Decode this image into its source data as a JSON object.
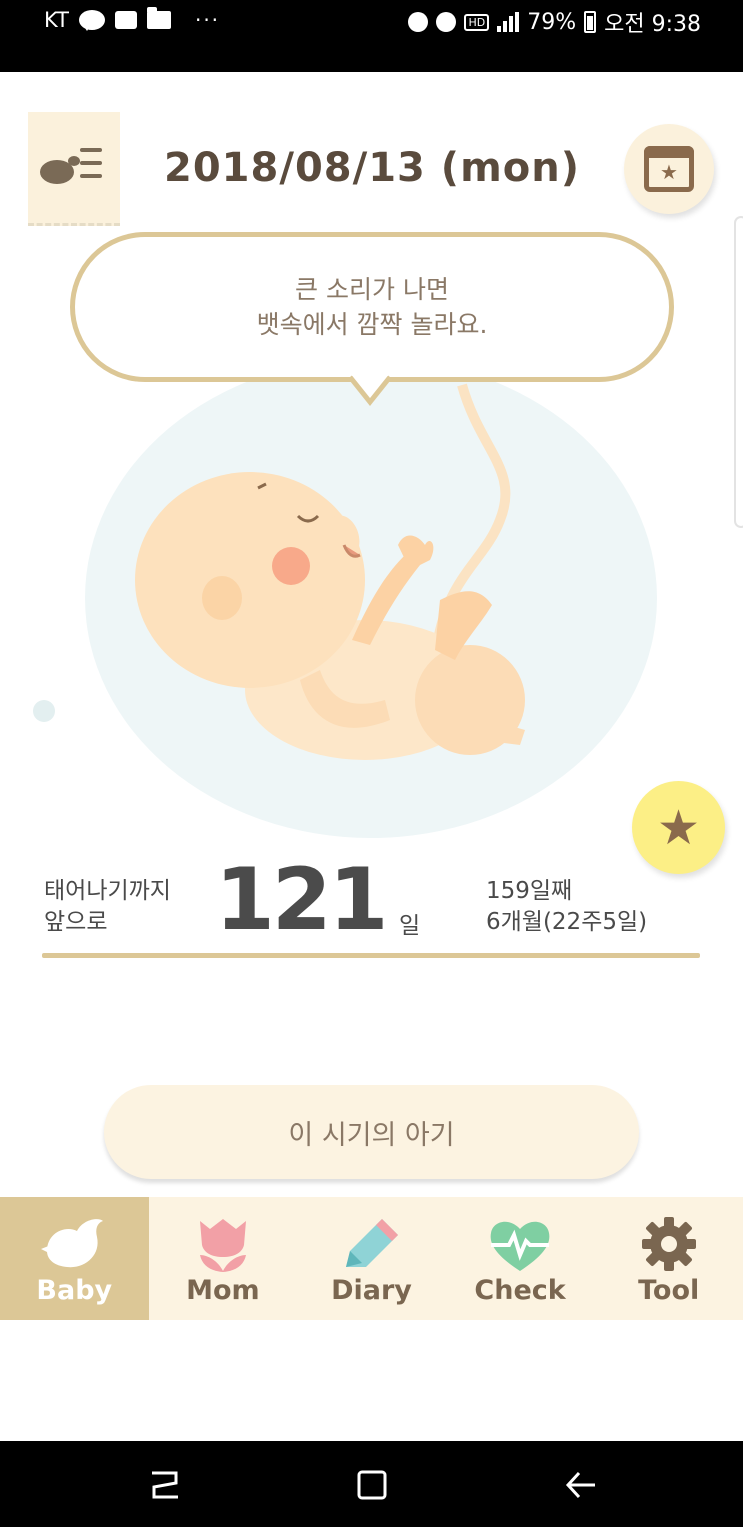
{
  "status_bar": {
    "carrier": "KT",
    "talk_icon": "TALK",
    "more": "···",
    "hd": "HD",
    "battery": "79%",
    "time": "오전 9:38"
  },
  "header": {
    "menu_icon": "menu-chick-icon",
    "date": "2018/08/13 (mon)",
    "calendar_icon": "calendar-star-icon"
  },
  "speech": {
    "line1": "큰 소리가 나면",
    "line2": "뱃속에서 깜짝 놀라요."
  },
  "countdown": {
    "label_line1": "태어나기까지",
    "label_line2": "앞으로",
    "days_left": "121",
    "unit": "일",
    "day_count": "159일째",
    "month_week": "6개월(22주5일)"
  },
  "period_button": "이 시기의 아기",
  "favorite_icon": "star-icon",
  "tabs": [
    {
      "label": "Baby",
      "icon": "bird-icon",
      "active": true
    },
    {
      "label": "Mom",
      "icon": "tulip-icon",
      "active": false
    },
    {
      "label": "Diary",
      "icon": "pencil-icon",
      "active": false
    },
    {
      "label": "Check",
      "icon": "heartbeat-icon",
      "active": false
    },
    {
      "label": "Tool",
      "icon": "gear-icon",
      "active": false
    }
  ],
  "colors": {
    "accent_tan": "#dcc796",
    "cream": "#fcf3e1",
    "favorite_yellow": "#fcef86",
    "text_brown": "#7a6650"
  }
}
